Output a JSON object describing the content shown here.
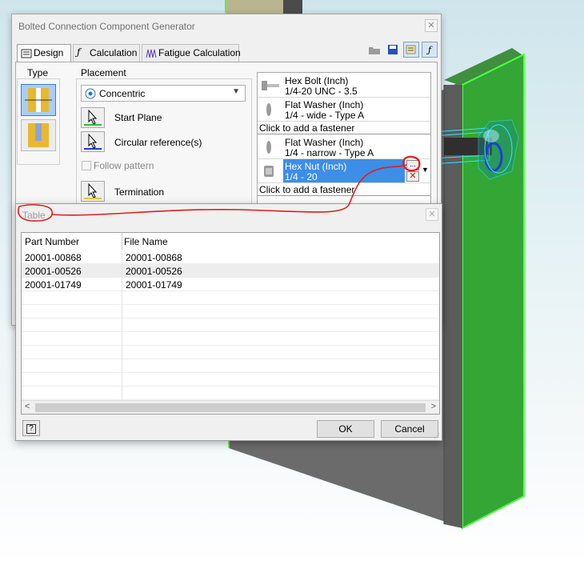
{
  "main_dialog": {
    "title": "Bolted Connection Component Generator",
    "tabs": [
      "Design",
      "Calculation",
      "Fatigue Calculation"
    ],
    "type_group_label": "Type",
    "placement_group_label": "Placement",
    "placement_value": "Concentric",
    "start_plane_label": "Start Plane",
    "circular_reference_label": "Circular reference(s)",
    "follow_pattern_label": "Follow pattern",
    "termination_label": "Termination",
    "fasteners": [
      {
        "line1": "Hex Bolt (Inch)",
        "line2": "1/4-20 UNC - 3.5"
      },
      {
        "line1": "Flat Washer (Inch)",
        "line2": "1/4 - wide - Type A"
      },
      {
        "line1": "Flat Washer (Inch)",
        "line2": "1/4 - narrow - Type A"
      },
      {
        "line1": "Hex Nut (Inch)",
        "line2": "1/4 - 20"
      }
    ],
    "add_fastener_label": "Click to add a fastener",
    "more_button": "...",
    "selected_color": "#3d8ee8"
  },
  "table_dialog": {
    "title": "Table",
    "columns": [
      "Part Number",
      "File Name"
    ],
    "rows": [
      [
        "20001-00868",
        "20001-00868"
      ],
      [
        "20001-00526",
        "20001-00526"
      ],
      [
        "20001-01749",
        "20001-01749"
      ]
    ],
    "ok_label": "OK",
    "cancel_label": "Cancel",
    "help_label": "?"
  },
  "colors": {
    "plate_green": "#33a636",
    "plate_gray": "#6b6b6b",
    "annotation_red": "#e0201a"
  }
}
